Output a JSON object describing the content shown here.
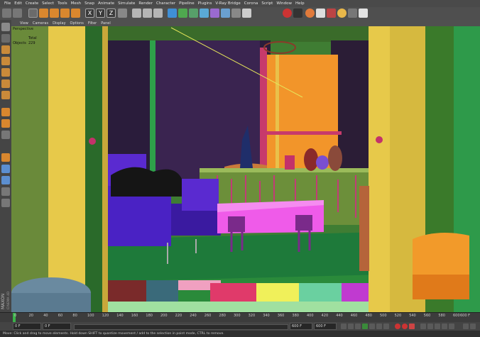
{
  "menu": [
    "File",
    "Edit",
    "Create",
    "Select",
    "Tools",
    "Mesh",
    "Snap",
    "Animate",
    "Simulate",
    "Render",
    "Character",
    "Pipeline",
    "Plugins",
    "V-Ray Bridge",
    "Corona",
    "Script",
    "Window",
    "Help"
  ],
  "toolbar": {
    "axis_x": "X",
    "axis_y": "Y",
    "axis_z": "Z"
  },
  "viewport_menu": [
    "View",
    "Cameras",
    "Display",
    "Options",
    "Filter",
    "Panel"
  ],
  "viewport": {
    "camera_label": "Perspective",
    "stats_header": "Total",
    "stats_label": "Objects",
    "stats_value": "229"
  },
  "logo": {
    "line1": "MAXON",
    "line2": "CINEMA 4D"
  },
  "timeline": {
    "ticks": [
      "0",
      "20",
      "40",
      "60",
      "80",
      "100",
      "120",
      "140",
      "160",
      "180",
      "200",
      "220",
      "240",
      "260",
      "280",
      "300",
      "320",
      "340",
      "360",
      "380",
      "400",
      "420",
      "440",
      "460",
      "480",
      "500",
      "520",
      "540",
      "560",
      "580",
      "600"
    ],
    "end_label": "600 F"
  },
  "playbar": {
    "start_field": "0 F",
    "current_field": "0 F",
    "end_field": "600 F",
    "max_field": "600 F"
  },
  "status": "Move: Click and drag to move elements. Hold down SHIFT to quantize movement / add to the selection in point mode, CTRL to remove.",
  "colors": {
    "floor": "#1e7a3a",
    "curtain": "#e7c94a",
    "wall": "#2b1f3a",
    "sofa": "#4a22c4",
    "table": "#ef5be9",
    "window": "#f29a27"
  }
}
